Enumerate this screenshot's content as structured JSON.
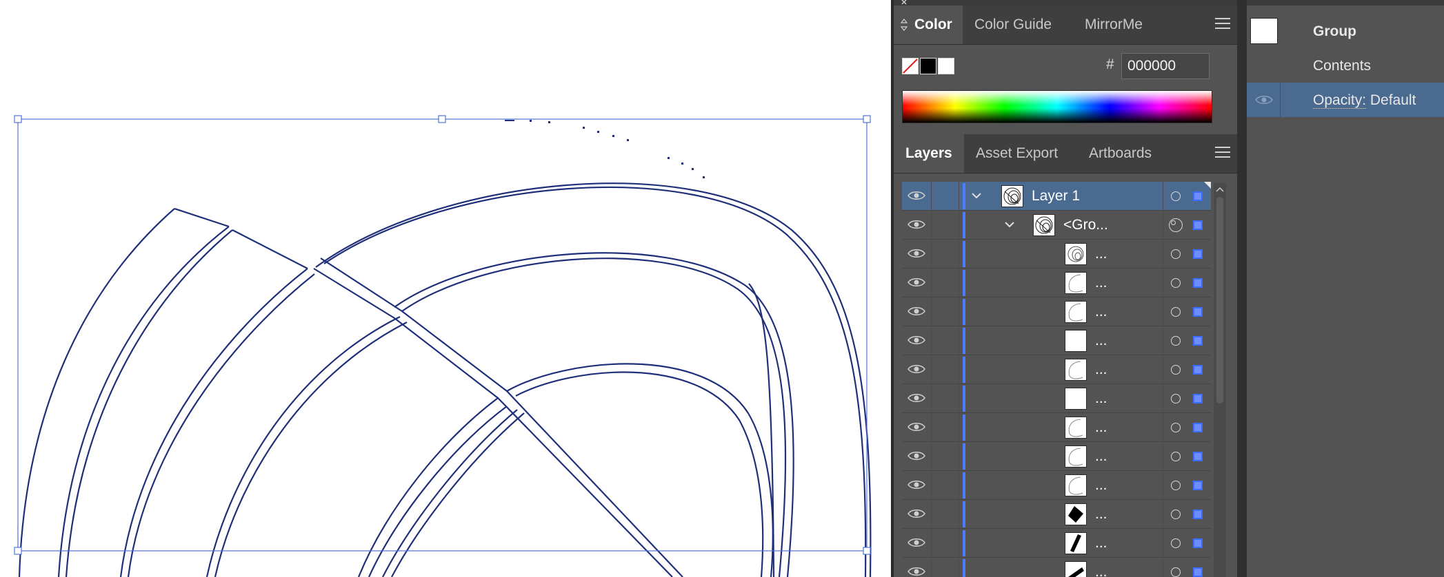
{
  "color_panel": {
    "tabs": [
      {
        "label": "Color",
        "active": true
      },
      {
        "label": "Color Guide",
        "active": false
      },
      {
        "label": "MirrorMe",
        "active": false
      }
    ],
    "hex_label": "#",
    "hex_value": "000000"
  },
  "layers_panel": {
    "tabs": [
      {
        "label": "Layers",
        "active": true
      },
      {
        "label": "Asset Export",
        "active": false
      },
      {
        "label": "Artboards",
        "active": false
      }
    ],
    "rows": [
      {
        "label": "Layer 1",
        "thumb": "rings",
        "expanded": true,
        "selected": true
      },
      {
        "label": "<Gro...",
        "thumb": "rings",
        "expanded": true,
        "selected": false
      },
      {
        "label": "...",
        "thumb": "rings-small"
      },
      {
        "label": "...",
        "thumb": "arc"
      },
      {
        "label": "...",
        "thumb": "arc"
      },
      {
        "label": "...",
        "thumb": "blank"
      },
      {
        "label": "...",
        "thumb": "arc"
      },
      {
        "label": "...",
        "thumb": "blank"
      },
      {
        "label": "...",
        "thumb": "arc"
      },
      {
        "label": "...",
        "thumb": "arc"
      },
      {
        "label": "...",
        "thumb": "arc"
      },
      {
        "label": "...",
        "thumb": "diamond"
      },
      {
        "label": "...",
        "thumb": "slash"
      },
      {
        "label": "...",
        "thumb": "slash2"
      }
    ]
  },
  "appearance_panel": {
    "group_label": "Group",
    "contents_label": "Contents",
    "opacity_label": "Opacity:",
    "opacity_value": "Default"
  },
  "colors": {
    "panel_bg": "#535353",
    "selection": "#4b6a8f",
    "layer_color": "#4f7bff",
    "path": "#1f2f7a"
  }
}
